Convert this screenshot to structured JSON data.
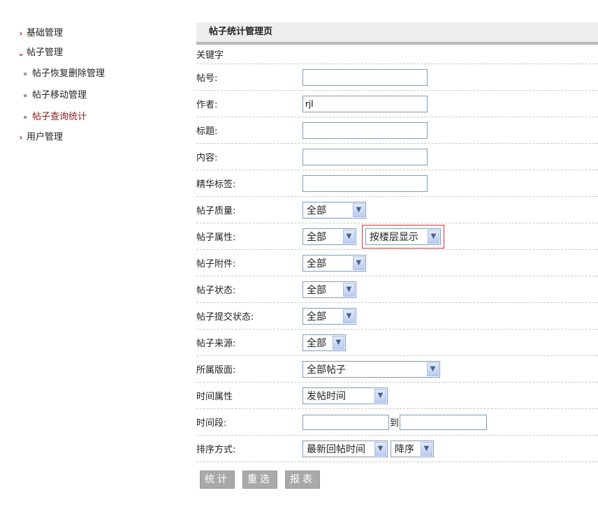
{
  "sidebar": {
    "items": [
      {
        "label": "基础管理",
        "icon": "chevron-right-icon"
      },
      {
        "label": "帖子管理",
        "icon": "chevron-down-icon"
      },
      {
        "label": "帖子恢复删除管理"
      },
      {
        "label": "帖子移动管理"
      },
      {
        "label": "帖子查询统计"
      },
      {
        "label": "用户管理",
        "icon": "chevron-right-icon"
      }
    ]
  },
  "header": {
    "title": "帖子统计管理页"
  },
  "form": {
    "keyword_label": "关键字",
    "post_no_label": "帖号:",
    "post_no_value": "",
    "author_label": "作者:",
    "author_value": "rjl",
    "title_label": "标题:",
    "title_value": "",
    "content_label": "内容:",
    "content_value": "",
    "tag_label": "精华标签:",
    "tag_value": "",
    "quality_label": "帖子质量:",
    "quality_value": "全部",
    "attr_label": "帖子属性:",
    "attr_value": "全部",
    "floor_value": "按楼层显示",
    "attachment_label": "帖子附件:",
    "attachment_value": "全部",
    "status_label": "帖子状态:",
    "status_value": "全部",
    "submit_status_label": "帖子提交状态:",
    "submit_status_value": "全部",
    "source_label": "帖子来源:",
    "source_value": "全部",
    "board_label": "所属版面:",
    "board_value": "全部帖子",
    "time_attr_label": "时间属性",
    "time_attr_value": "发帖时间",
    "time_range_label": "时间段:",
    "time_from": "",
    "time_to_sep": "到",
    "time_to": "",
    "sort_label": "排序方式:",
    "sort_value": "最新回帖时间",
    "order_value": "降序"
  },
  "buttons": {
    "stat": "统计",
    "reset": "重选",
    "report": "报表"
  },
  "colors": {
    "highlight": "#dd3333",
    "active_nav": "#8b1a1a",
    "button_bg": "#a9a9a9"
  }
}
